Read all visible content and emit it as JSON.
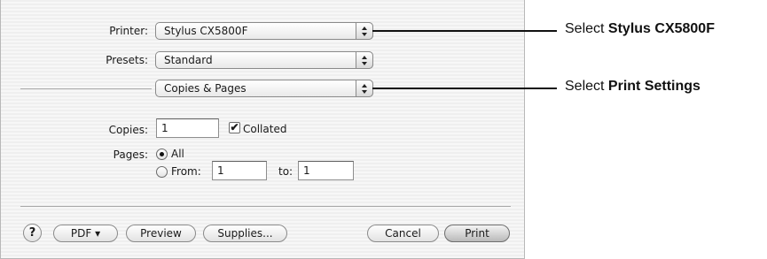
{
  "dialog": {
    "printer_label": "Printer:",
    "printer_value": "Stylus CX5800F",
    "presets_label": "Presets:",
    "presets_value": "Standard",
    "section_value": "Copies & Pages",
    "copies_label": "Copies:",
    "copies_value": "1",
    "collated_label": "Collated",
    "collated_checked": true,
    "check_mark": "✔",
    "pages_label": "Pages:",
    "all_label": "All",
    "from_label": "From:",
    "from_value": "1",
    "to_label": "to:",
    "to_value": "1",
    "help_label": "?",
    "pdf_label": "PDF ▾",
    "preview_label": "Preview",
    "supplies_label": "Supplies...",
    "cancel_label": "Cancel",
    "print_label": "Print"
  },
  "callouts": {
    "printer": {
      "prefix": "Select ",
      "target": "Stylus CX5800F"
    },
    "settings": {
      "prefix": "Select ",
      "target": "Print Settings"
    }
  }
}
